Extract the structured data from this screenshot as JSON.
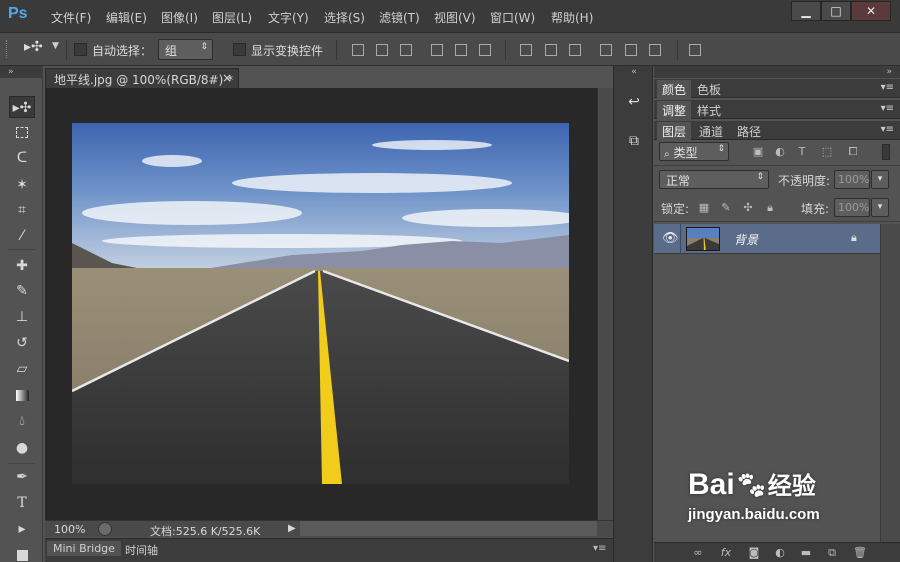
{
  "app": {
    "logo": "Ps"
  },
  "menu": [
    "文件(F)",
    "编辑(E)",
    "图像(I)",
    "图层(L)",
    "文字(Y)",
    "选择(S)",
    "滤镜(T)",
    "视图(V)",
    "窗口(W)",
    "帮助(H)"
  ],
  "window_controls": {
    "minimize": "▁",
    "maximize": "□",
    "close": "✕"
  },
  "options": {
    "auto_select_label": "自动选择：",
    "auto_select_value": "组",
    "show_transform_label": "显示变换控件"
  },
  "document": {
    "tab_title": "地平线.jpg @ 100%(RGB/8#) *",
    "tab_close": "×",
    "zoom": "100%",
    "doc_info": "文档:525.6 K/525.6K"
  },
  "bottom_tabs": [
    "Mini Bridge",
    "时间轴"
  ],
  "panels": {
    "color_tabs": [
      "颜色",
      "色板"
    ],
    "adjust_tabs": [
      "调整",
      "样式"
    ],
    "layer_tabs": [
      "图层",
      "通道",
      "路径"
    ],
    "filter_kind": "类型",
    "blend_mode": "正常",
    "opacity_label": "不透明度:",
    "opacity_value": "100%",
    "lock_label": "锁定:",
    "fill_label": "填充:",
    "fill_value": "100%"
  },
  "layers": [
    {
      "name": "背景",
      "visible": true,
      "locked": true
    }
  ],
  "watermark": {
    "text": "Bai",
    "text2": "经验",
    "url": "jingyan.baidu.com"
  },
  "colors": {
    "ps_blue": "#4ea9f0",
    "panel_bg": "#535353",
    "canvas_bg": "#282828",
    "layer_selected": "#5a6c8a",
    "center_line": "#f2cc1a"
  }
}
